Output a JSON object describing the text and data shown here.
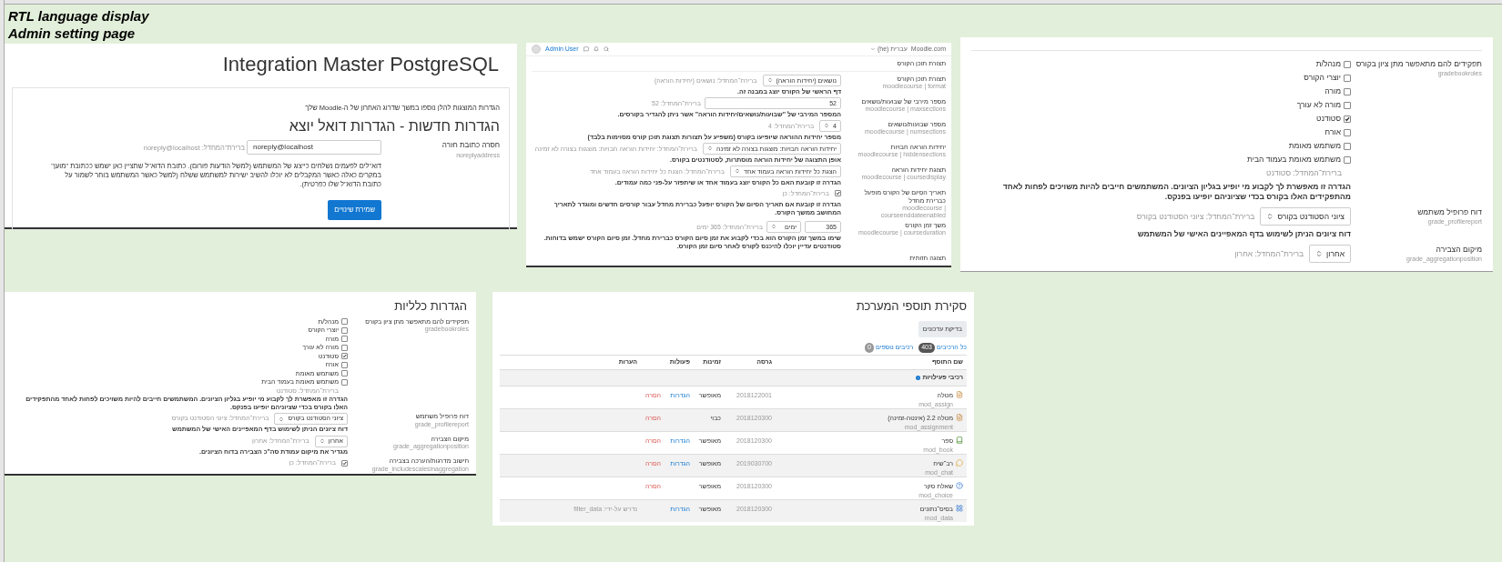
{
  "sheet": {
    "titles": [
      "RTL language display",
      "Admin setting page"
    ]
  },
  "email_panel": {
    "site_title": "Integration Master PostgreSQL",
    "notice": "הגדרות המוצגות להלן נוספו במשך שדרוג האחרון של ה-Moodle שלך",
    "heading": "הגדרות חדשות - הגדרות דואל יוצא",
    "setting": {
      "label": "חסרה כתובת חזרה",
      "key": "noreplyaddress",
      "value": "noreply@localhost",
      "default": "ברירת־המחדל: noreply@localhost",
      "description": "דוא\"לים לפעמים נשלחים כייצוג של המשתמש (למשל הודעות פורום). כתובת הדוא\"ל שתציין כאן ישמש ככתובת \"מוען\" במקרים כאלה כאשר המקבלים לא יוכלו להשיב ישירות למשתמש ששלח (למשל כאשר המשתמש בוחר לשמור על כתובת הדוא\"ל שלו כפרטית)."
    },
    "save_button": "שמירת שינויים"
  },
  "course_panel": {
    "header": {
      "user": "Admin User",
      "site": "Moodle.com",
      "language": "עברית (he)"
    },
    "section_title": "תצורת תוכן הקורס",
    "settings": [
      {
        "kind": "select",
        "label": "תצורת תוכן הקורס",
        "key": "moodlecourse | format",
        "value": "נושאים (יחידות הוראה)",
        "default": "ברירת־המחדל: נושאים (יחידות הוראה)",
        "description": "דף הראשי של הקורס יוצג במבנה זה."
      },
      {
        "kind": "text",
        "label": "מספר מירבי של שבועות/נושאים",
        "key": "moodlecourse | maxsections",
        "value": "52",
        "default": "ברירת־המחדל: 52",
        "description": "המספר המירבי של \"שבועות/נושאים/יחידות הוראה\" אשר ניתן להגדיר בקורסים."
      },
      {
        "kind": "select",
        "label": "מספר שבועות/נושאים",
        "key": "moodlecourse | numsections",
        "value": "4",
        "default": "ברירת־המחדל: 4",
        "description": "מספר יחידות ההוראה שיופיעו בקורס (משפיע על תצורות תצוגת תוכן קורס מסוימות בלבד)"
      },
      {
        "kind": "select",
        "label": "יחידות הוראה חבויות",
        "key": "moodlecourse | hiddensections",
        "value": "יחידות הוראה חבויות: מוצגות בצורה לא זמינה",
        "default": "ברירת־המחדל: יחידות הוראה חבויות: מוצגות בצורה לא זמינה",
        "description": "אופן התצוגה של יחידות הוראה מוסתרות, לסטודנטים בקורס."
      },
      {
        "kind": "select",
        "label": "תצוגת יחידות הוראה",
        "key": "moodlecourse | coursedisplay",
        "value": "הצגת כל יחידות הוראה בעמוד אחד",
        "default": "ברירת־המחדל: הצגת כל יחידות הוראה בעמוד אחד",
        "description": "הגדרה זו קובעת האם כל הקורס יוצג בעמוד אחד או שיתפזר על-פני כמה עמודים."
      },
      {
        "kind": "checkbox",
        "label": "תאריך הסיום של הקורס מופעל כברירת מחדל",
        "key": "moodlecourse | courseenddateenabled",
        "checked": true,
        "default": "ברירת־המחדל: כן",
        "description": "הגדרה זו קובעת אם תאריך הסיום של הקורס יופעל כברירת מחדל עבור קורסים חדשים ומוגדר לתאריך המחושב ממשך הקורס."
      },
      {
        "kind": "duration",
        "label": "משך זמן הקורס",
        "key": "moodlecourse | courseduration",
        "value": "365",
        "unit": "ימים",
        "default": "ברירת־המחדל: 365 ימים",
        "description": "שימו במשך זמן הקורס הוא בכדי לקבוע את זמן סיום הקורס כברירת מחדל. זמן סיום הקורס ישמש בדוחות. סטודנטים עדיין יוכלו להיכנס לקורס לאחר סיום זמן הקורס."
      }
    ],
    "next_section": "תצוגה חזותית"
  },
  "grade_panel_top": {
    "settings": [
      {
        "kind": "checklist",
        "label": "תפקידים להם מתאפשר מתן ציון בקורס",
        "key": "gradebookroles",
        "options": [
          {
            "label": "מנהל/ת",
            "checked": false
          },
          {
            "label": "יוצרי הקורס",
            "checked": false
          },
          {
            "label": "מורה",
            "checked": false
          },
          {
            "label": "מורה לא עורך",
            "checked": false
          },
          {
            "label": "סטודנט",
            "checked": true
          },
          {
            "label": "אורח",
            "checked": false
          },
          {
            "label": "משתמש מאומת",
            "checked": false
          },
          {
            "label": "משתמש מאומת בעמוד הבית",
            "checked": false
          }
        ],
        "default": "ברירת־המחדל: סטודנט",
        "description": "הגדרה זו מאפשרת לך לקבוע מי יופיע בגליון הציונים. המשתמשים חייבים להיות משויכים לפחות לאחד מהתפקידים האלו בקורס בכדי שציוניהם יופיעו בפנקס."
      },
      {
        "kind": "select",
        "label": "דוח פרופיל משתמש",
        "key": "grade_profilereport",
        "value": "ציוני הסטודנט בקורס",
        "default": "ברירת־המחדל: ציוני הסטודנט בקורס",
        "description": "דוח ציונים הניתן לשימוש בדף המאפיינים האישי של המשתמש"
      },
      {
        "kind": "select",
        "label": "מיקום הצבירה",
        "key": "grade_aggregationposition",
        "value": "אחרון",
        "default": "ברירת־המחדל: אחרון"
      }
    ]
  },
  "grade_panel_general": {
    "title": "הגדרות כלליות",
    "settings": [
      {
        "kind": "checklist",
        "label": "תפקידים להם מתאפשר מתן ציון בקורס",
        "key": "gradebookroles",
        "options": [
          {
            "label": "מנהל/ת",
            "checked": false
          },
          {
            "label": "יוצרי הקורס",
            "checked": false
          },
          {
            "label": "מורה",
            "checked": false
          },
          {
            "label": "מורה לא עורך",
            "checked": false
          },
          {
            "label": "סטודנט",
            "checked": true
          },
          {
            "label": "אורח",
            "checked": false
          },
          {
            "label": "משתמש מאומת",
            "checked": false
          },
          {
            "label": "משתמש מאומת בעמוד הבית",
            "checked": false
          }
        ],
        "default": "ברירת־המחדל: סטודנט",
        "description": "הגדרה זו מאפשרת לך לקבוע מי יופיע בגליון הציונים. המשתמשים חייבים להיות משויכים לפחות לאחד מהתפקידים האלו בקורס בכדי שציוניהם יופיעו בפנקס."
      },
      {
        "kind": "select",
        "label": "דוח פרופיל משתמש",
        "key": "grade_profilereport",
        "value": "ציוני הסטודנט בקורס",
        "default": "ברירת־המחדל: ציוני הסטודנט בקורס",
        "description": "דוח ציונים הניתן לשימוש בדף המאפיינים האישי של המשתמש"
      },
      {
        "kind": "select",
        "label": "מיקום הצבירה",
        "key": "grade_aggregationposition",
        "value": "אחרון",
        "default": "ברירת־המחדל: אחרון",
        "description": "מגדיר את מיקום עמודת סה\"כ הצבירה בדוח הציונים."
      },
      {
        "kind": "checkbox",
        "label": "חישוב מדרגות/הערכה בצבירה",
        "key": "grade_includescalesinaggregation",
        "checked": true,
        "default": "ברירת־המחדל: כן"
      }
    ]
  },
  "plugins_panel": {
    "title": "סקירת תוספי המערכת",
    "check_button": "בדיקת עדכונים",
    "filters": [
      {
        "label": "כל הרכיבים",
        "count": "403",
        "selected": true
      },
      {
        "label": "רכיבים נוספים",
        "count": "0",
        "selected": false
      }
    ],
    "columns": [
      "שם התוסף",
      "גרסה",
      "זמינות",
      "פעולות",
      "הערות"
    ],
    "group": "רכיבי פעילויות",
    "rows": [
      {
        "kind": "assign",
        "name": "מטלה",
        "component": "mod_assign",
        "version": "2018122001",
        "availability": "מאופשר",
        "settings": "הגדרות",
        "uninstall": "הסרה"
      },
      {
        "kind": "assign",
        "name": "מטלה 2.2 (אינטה-זמינה)",
        "component": "mod_assignment",
        "version": "2018120300",
        "availability": "כבוי",
        "uninstall": "הסרה"
      },
      {
        "kind": "book",
        "name": "ספר",
        "component": "mod_book",
        "version": "2018120300",
        "availability": "מאופשר",
        "settings": "הגדרות",
        "uninstall": "הסרה"
      },
      {
        "kind": "chat",
        "name": "רב־שיח",
        "component": "mod_chat",
        "version": "2019030700",
        "availability": "מאופשר",
        "settings": "הגדרות",
        "uninstall": "הסרה"
      },
      {
        "kind": "choice",
        "name": "שאלת סקר",
        "component": "mod_choice",
        "version": "2018120300",
        "availability": "מאופשר",
        "uninstall": "הסרה"
      },
      {
        "kind": "data",
        "name": "בסיס־נתונים",
        "component": "mod_data",
        "version": "2018120300",
        "availability": "מאופשר",
        "settings": "הגדרות",
        "note": "נדרש על-ידי: filter_data"
      }
    ]
  }
}
